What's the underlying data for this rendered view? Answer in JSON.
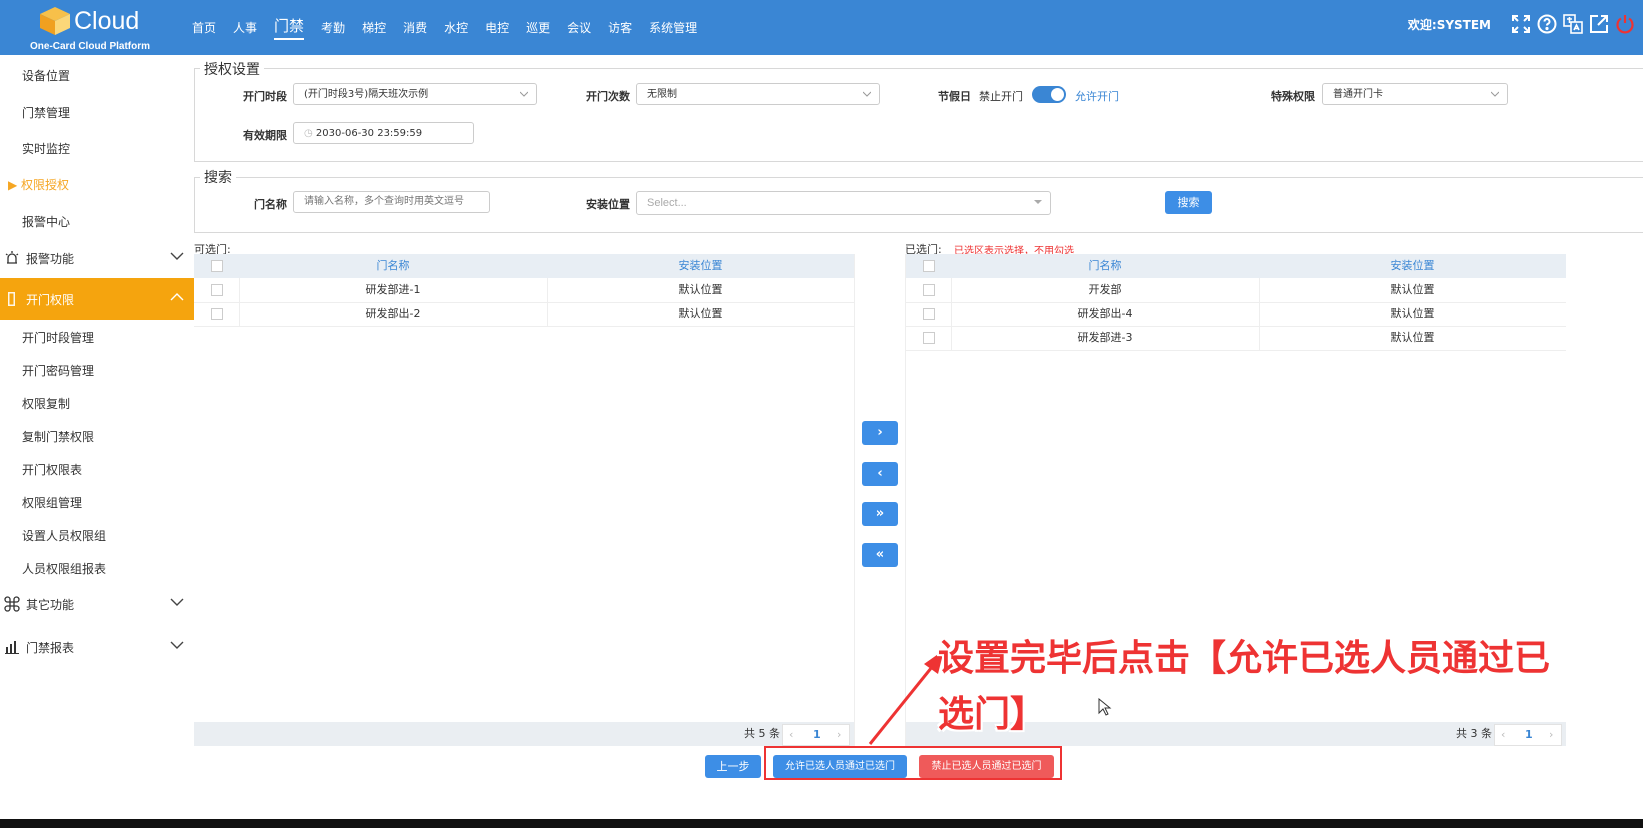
{
  "header": {
    "brand": "Cloud",
    "subtitle": "One-Card Cloud Platform",
    "nav": [
      "首页",
      "人事",
      "门禁",
      "考勤",
      "梯控",
      "消费",
      "水控",
      "电控",
      "巡更",
      "会议",
      "访客",
      "系统管理"
    ],
    "active_nav": "门禁",
    "welcome": "欢迎:SYSTEM",
    "icons": [
      "fullscreen-icon",
      "help-icon",
      "translate-icon",
      "external-link-icon",
      "power-icon"
    ]
  },
  "sidebar": {
    "top_links": [
      "设备位置",
      "门禁管理",
      "实时监控",
      "权限授权",
      "报警中心"
    ],
    "active_link": "权限授权",
    "groups": {
      "alarm": {
        "label": "报警功能",
        "icon": "alarm-icon"
      },
      "door_permission": {
        "label": "开门权限",
        "icon": "door-icon"
      },
      "other": {
        "label": "其它功能",
        "icon": "command-icon"
      },
      "reports": {
        "label": "门禁报表",
        "icon": "chart-icon"
      }
    },
    "sub_links": [
      "开门时段管理",
      "开门密码管理",
      "权限复制",
      "复制门禁权限",
      "开门权限表",
      "权限组管理",
      "设置人员权限组",
      "人员权限组报表"
    ]
  },
  "auth": {
    "legend": "授权设置",
    "period_label": "开门时段",
    "period_value": "(开门时段3号)隔天班次示例",
    "count_label": "开门次数",
    "count_value": "无限制",
    "holiday_label": "节假日",
    "holiday_off": "禁止开门",
    "holiday_on": "允许开门",
    "special_label": "特殊权限",
    "special_value": "普通开门卡",
    "valid_label": "有效期限",
    "valid_value": "2030-06-30 23:59:59"
  },
  "search": {
    "legend": "搜索",
    "name_label": "门名称",
    "name_placeholder": "请输入名称，多个查询时用英文逗号",
    "loc_label": "安装位置",
    "loc_placeholder": "Select...",
    "search_btn": "搜索"
  },
  "available": {
    "title": "可选门:",
    "columns": [
      "门名称",
      "安装位置"
    ],
    "rows": [
      {
        "name": "研发部进-1",
        "loc": "默认位置"
      },
      {
        "name": "研发部出-2",
        "loc": "默认位置"
      }
    ],
    "total": "共 5 条",
    "page": "1"
  },
  "selected": {
    "title": "已选门:",
    "note": "已选区表示选择，不用勾选",
    "columns": [
      "门名称",
      "安装位置"
    ],
    "rows": [
      {
        "name": "开发部",
        "loc": "默认位置"
      },
      {
        "name": "研发部出-4",
        "loc": "默认位置"
      },
      {
        "name": "研发部进-3",
        "loc": "默认位置"
      }
    ],
    "total": "共 3 条",
    "page": "1"
  },
  "transfer": [
    "›",
    "‹",
    "»",
    "«"
  ],
  "footer": {
    "prev": "上一步",
    "allow": "允许已选人员通过已选门",
    "deny": "禁止已选人员通过已选门"
  },
  "annotation": "设置完毕后点击【允许已选人员通过已选门】",
  "colors": {
    "primary": "#3a86d4",
    "sidebar_active": "#f5a40e",
    "danger": "#ef5a5a",
    "annotation": "#e33333"
  }
}
